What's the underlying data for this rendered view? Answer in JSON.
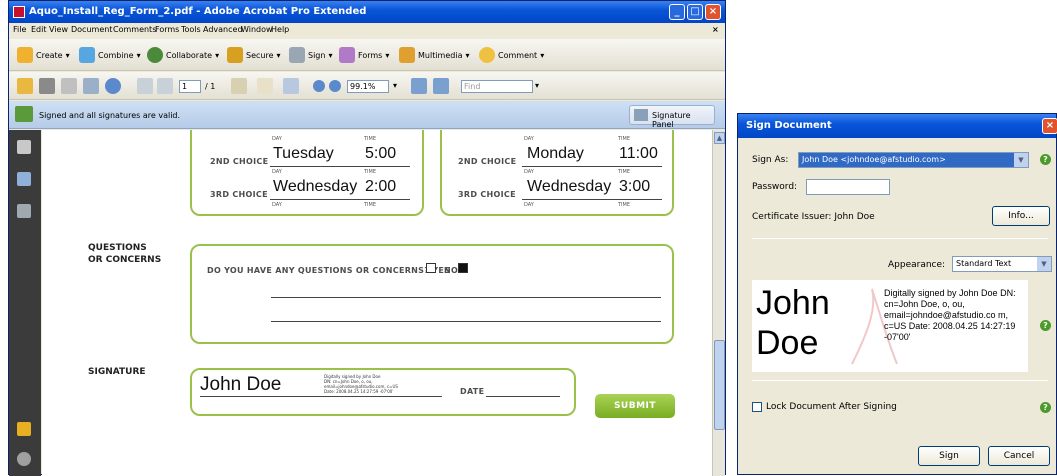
{
  "window": {
    "title": "Aquo_Install_Reg_Form_2.pdf - Adobe Acrobat Pro Extended",
    "menu": [
      "File",
      "Edit",
      "View",
      "Document",
      "Comments",
      "Forms",
      "Tools",
      "Advanced",
      "Window",
      "Help"
    ],
    "close_x": "×"
  },
  "toolbar1": {
    "create": "Create",
    "combine": "Combine",
    "collaborate": "Collaborate",
    "secure": "Secure",
    "sign": "Sign",
    "forms": "Forms",
    "multimedia": "Multimedia",
    "comment": "Comment"
  },
  "toolbar2": {
    "page_current": "1",
    "page_total": "/ 1",
    "zoom": "99.1%",
    "find_placeholder": "Find"
  },
  "sigbar": {
    "message": "Signed and all signatures are valid.",
    "panel_button": "Signature Panel"
  },
  "form": {
    "day_label": "DAY",
    "time_label": "TIME",
    "left": {
      "second_choice_label": "2ND CHOICE",
      "second_day": "Tuesday",
      "second_time": "5:00",
      "third_choice_label": "3RD CHOICE",
      "third_day": "Wednesday",
      "third_time": "2:00"
    },
    "right": {
      "second_choice_label": "2ND CHOICE",
      "second_day": "Monday",
      "second_time": "11:00",
      "third_choice_label": "3RD CHOICE",
      "third_day": "Wednesday",
      "third_time": "3:00"
    },
    "questions_heading_1": "QUESTIONS",
    "questions_heading_2": "OR CONCERNS",
    "questions_prompt": "DO YOU HAVE ANY QUESTIONS OR CONCERNS? YES",
    "no_label": "NO",
    "signature_heading": "SIGNATURE",
    "signature_name": "John Doe",
    "signature_detail_1": "Digitally signed by John Doe",
    "signature_detail_2": "DN: cn=John Doe, o, ou,",
    "signature_detail_3": "email=johndoe@afstudio.com, c=US",
    "signature_detail_4": "Date: 2008.04.25 14:27:59 -07'00'",
    "date_label": "DATE",
    "submit": "SUBMIT"
  },
  "dialog": {
    "title": "Sign Document",
    "sign_as_label": "Sign As:",
    "sign_as_value": "John Doe <johndoe@afstudio.com>",
    "password_label": "Password:",
    "password_value": "",
    "issuer_label": "Certificate Issuer: John Doe",
    "info_button": "Info...",
    "appearance_label": "Appearance:",
    "appearance_value": "Standard Text",
    "preview_name_1": "John",
    "preview_name_2": "Doe",
    "preview_detail": "Digitally signed by John Doe DN: cn=John Doe, o, ou, email=johndoe@afstudio.co m, c=US Date: 2008.04.25 14:27:19 -07'00'",
    "lock_label": "Lock Document After Signing",
    "sign_button": "Sign",
    "cancel_button": "Cancel",
    "help_glyph": "?"
  },
  "colors": {
    "form_green": "#9cc14a",
    "xp_blue": "#0a56d8"
  }
}
